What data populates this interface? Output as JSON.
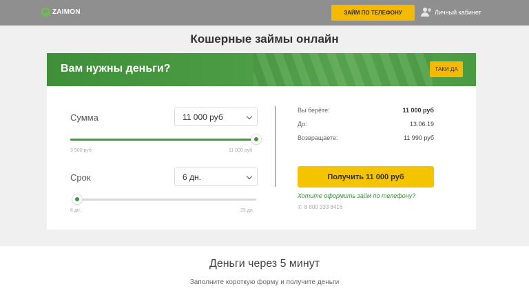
{
  "header": {
    "logo_text": "ZAIMON",
    "phone_loan_button": "ЗАЙМ ПО ТЕЛЕФОНУ",
    "cabinet_link": "Личный кабинет"
  },
  "page_title": "Кошерные займы онлайн",
  "banner": {
    "title": "Вам нужны деньги?",
    "button": "ТАКИ ДА"
  },
  "calculator": {
    "amount": {
      "label": "Сумма",
      "selected": "11 000 руб",
      "min_label": "3 500 руб",
      "max_label": "11 000 руб",
      "slider_fraction": 1.0
    },
    "term": {
      "label": "Срок",
      "selected": "6 дн.",
      "min_label": "6 дн.",
      "max_label": "25 дн.",
      "slider_fraction": 0.0
    },
    "summary": [
      {
        "label": "Вы берёте:",
        "value": "11 000 руб",
        "bold": true
      },
      {
        "label": "До:",
        "value": "13.06.19",
        "bold": false
      },
      {
        "label": "Возвращаете:",
        "value": "11 990 руб",
        "bold": false
      }
    ],
    "get_button": "Получить 11 000 руб",
    "phone_question": "Хотите оформить займ по телефону?",
    "phone_number": "8 800 333 8416"
  },
  "lower": {
    "title": "Деньги через 5 минут",
    "subtitle": "Заполните короткую форму и получите деньги"
  },
  "colors": {
    "accent_green": "#3c9a3a",
    "button_yellow": "#f5c400",
    "header_gray": "#8f8f8f"
  }
}
